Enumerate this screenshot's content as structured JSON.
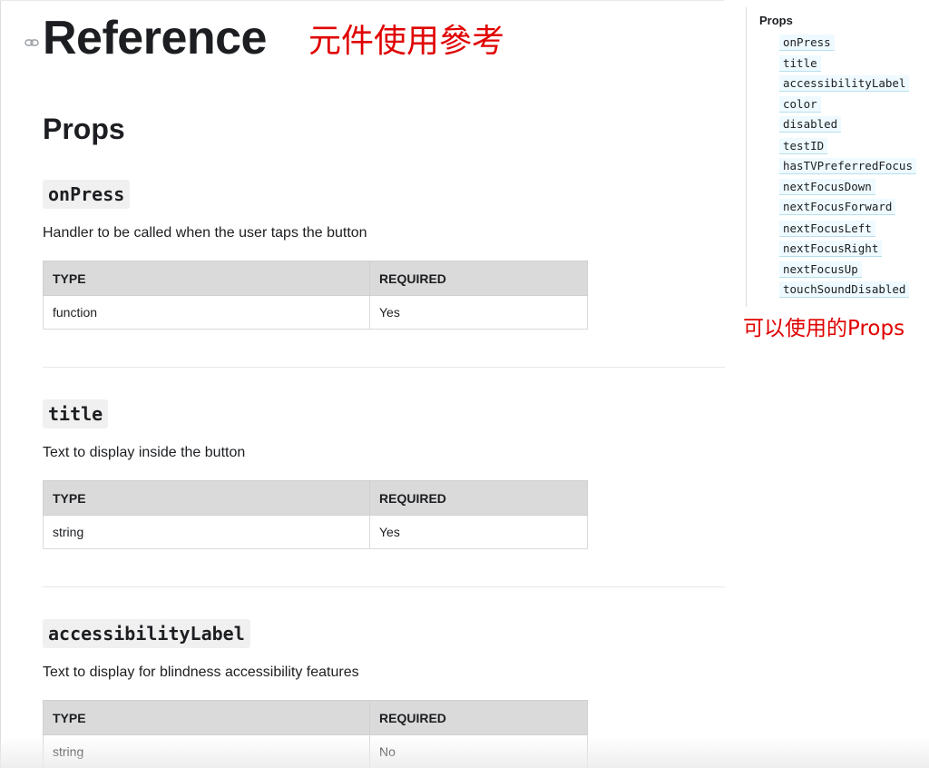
{
  "header": {
    "title": "Reference",
    "annotation": "元件使用參考"
  },
  "section": {
    "heading": "Props"
  },
  "props": [
    {
      "name": "onPress",
      "description": "Handler to be called when the user taps the button",
      "table": {
        "headers": [
          "TYPE",
          "REQUIRED"
        ],
        "row": [
          "function",
          "Yes"
        ]
      }
    },
    {
      "name": "title",
      "description": "Text to display inside the button",
      "table": {
        "headers": [
          "TYPE",
          "REQUIRED"
        ],
        "row": [
          "string",
          "Yes"
        ]
      }
    },
    {
      "name": "accessibilityLabel",
      "description": "Text to display for blindness accessibility features",
      "table": {
        "headers": [
          "TYPE",
          "REQUIRED"
        ],
        "row": [
          "string",
          "No"
        ]
      }
    }
  ],
  "toc": {
    "heading": "Props",
    "items": [
      "onPress",
      "title",
      "accessibilityLabel",
      "color",
      "disabled",
      "testID",
      "hasTVPreferredFocus",
      "nextFocusDown",
      "nextFocusForward",
      "nextFocusLeft",
      "nextFocusRight",
      "nextFocusUp",
      "touchSoundDisabled"
    ],
    "annotation": "可以使用的Props"
  },
  "colors": {
    "annotation": "#e00000",
    "text": "#1c1e21",
    "table_header_bg": "#dadada",
    "code_bg": "#f0f0f0",
    "toc_highlight": "#eefaff"
  },
  "icons": {
    "anchor": "link-icon"
  }
}
